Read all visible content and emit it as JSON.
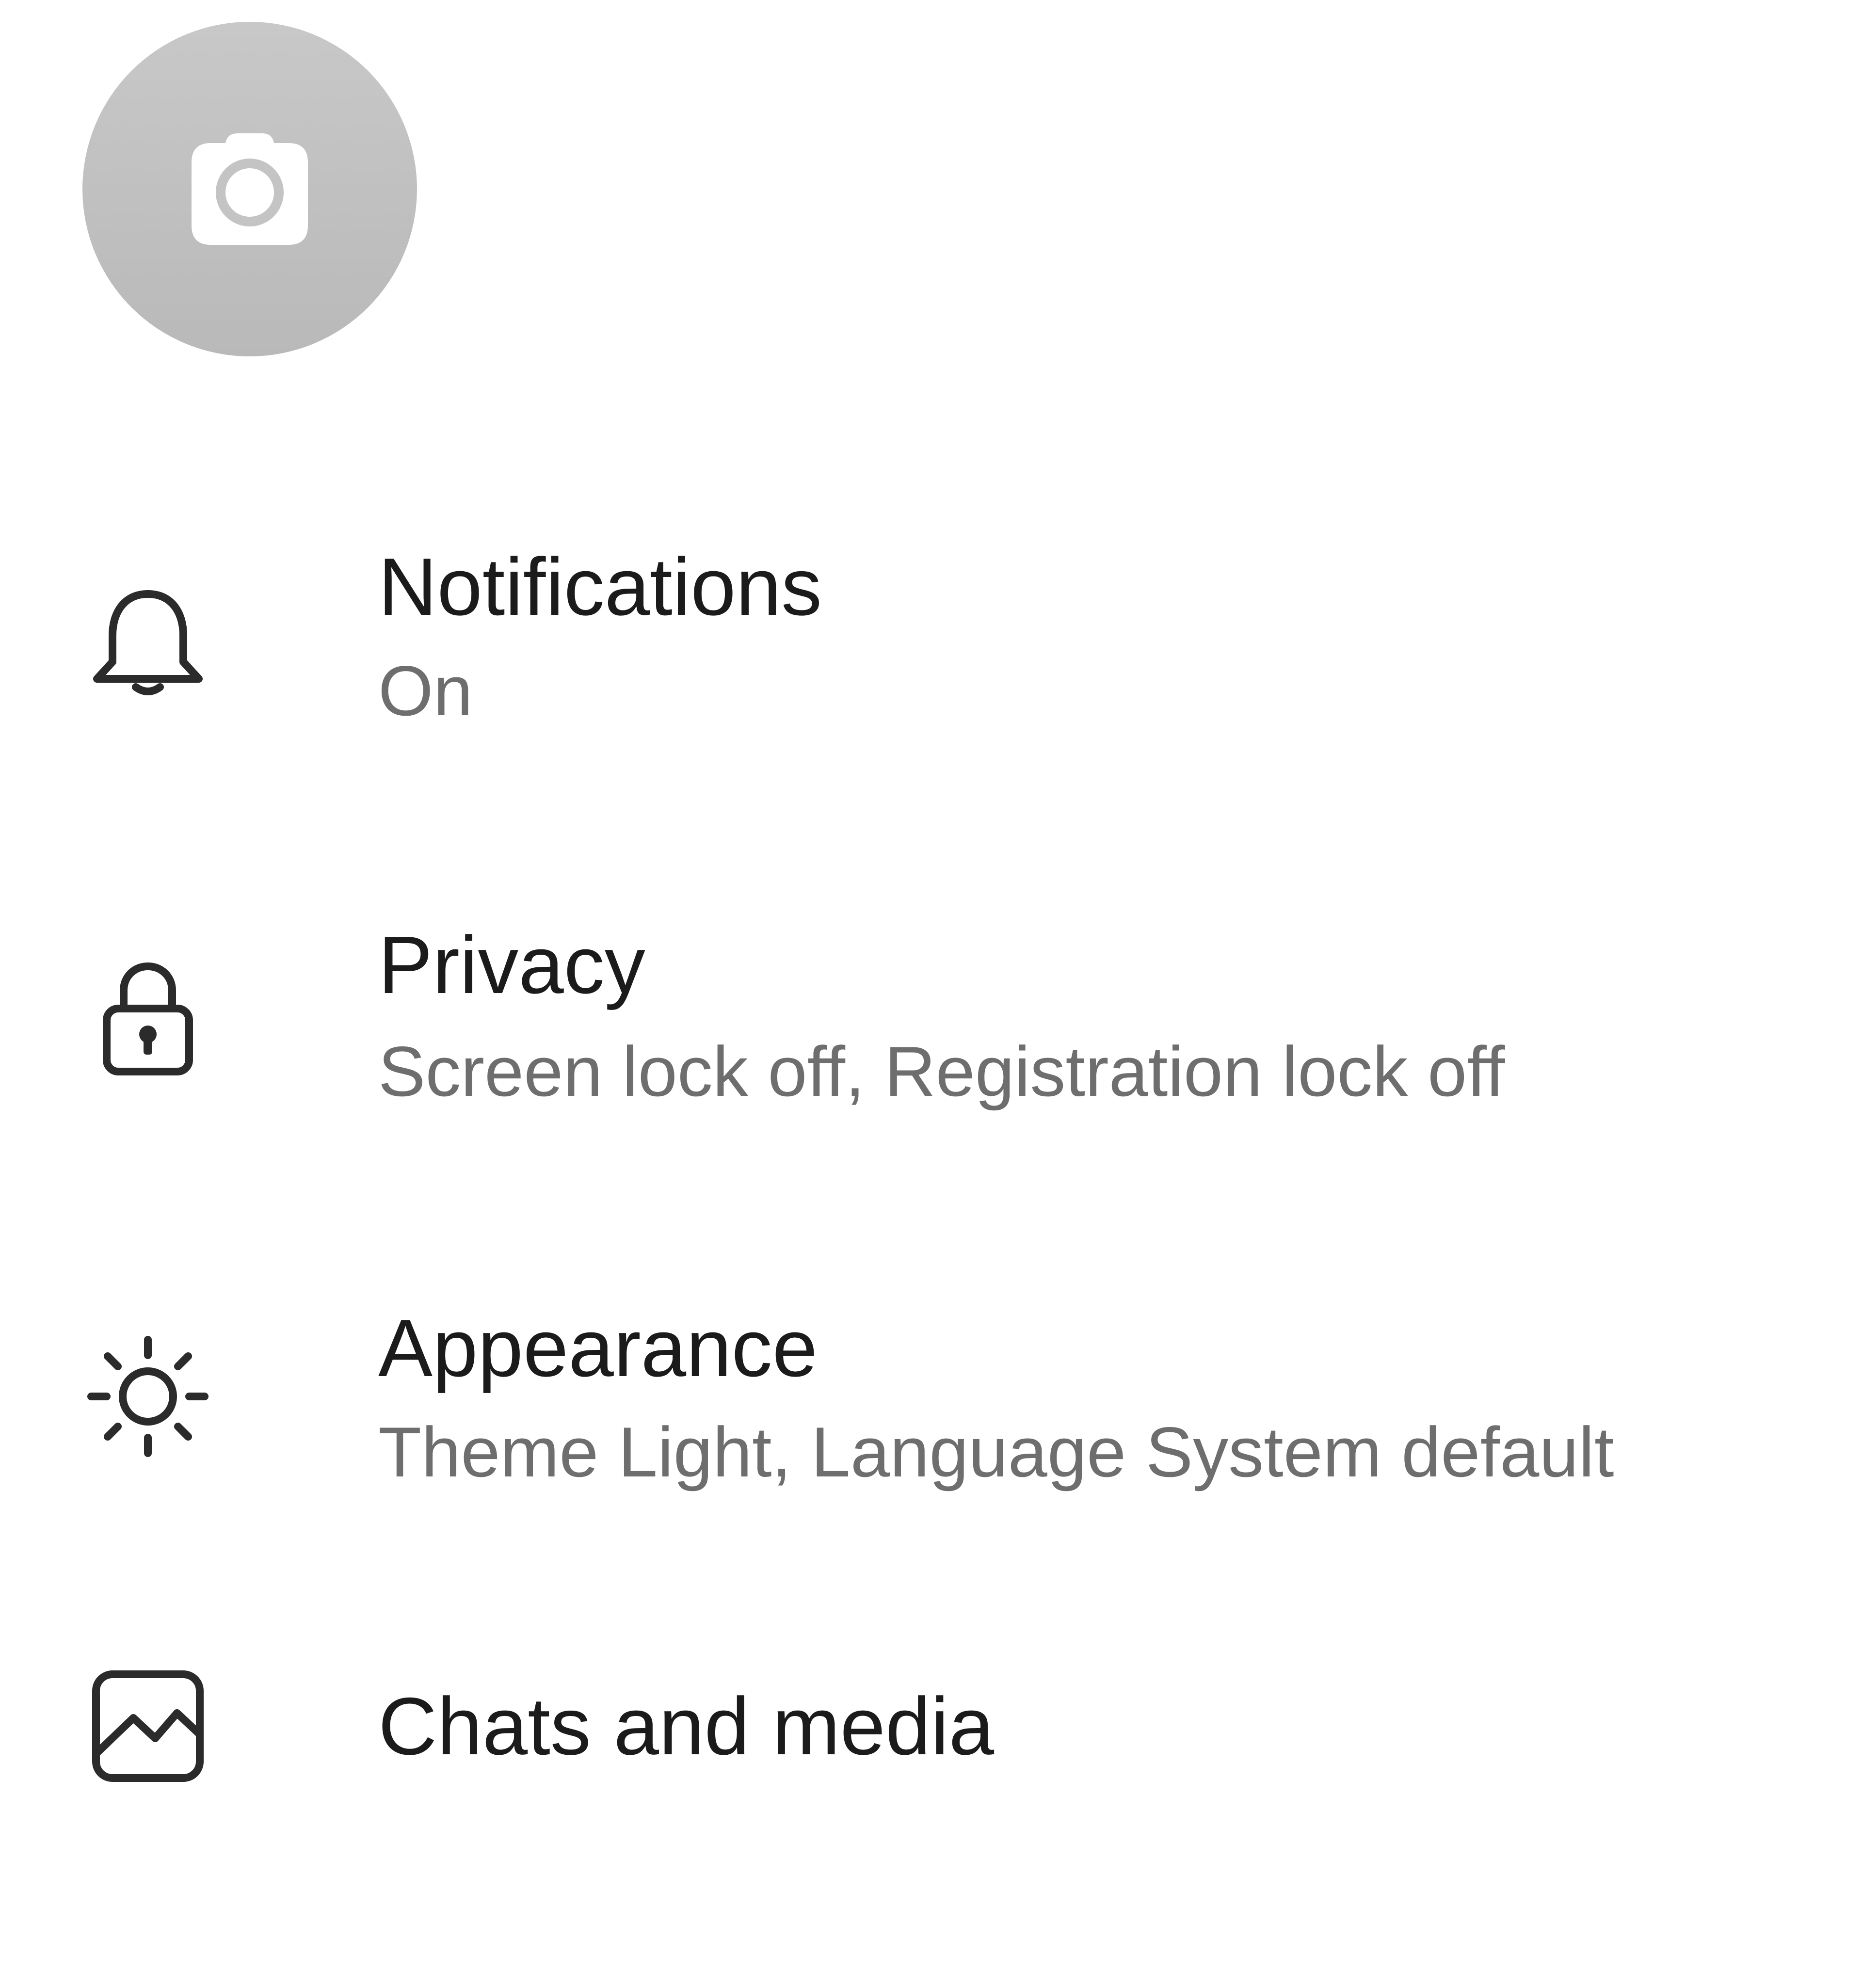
{
  "profile": {
    "avatar_icon": "camera-icon",
    "avatar_color": "#c2c2c2"
  },
  "settings": {
    "items": [
      {
        "icon": "bell-icon",
        "title": "Notifications",
        "summary": "On"
      },
      {
        "icon": "lock-icon",
        "title": "Privacy",
        "summary": "Screen lock off, Registration lock off"
      },
      {
        "icon": "sun-icon",
        "title": "Appearance",
        "summary": "Theme Light, Language System default"
      },
      {
        "icon": "image-icon",
        "title": "Chats and media"
      }
    ]
  },
  "colors": {
    "title_text": "#1b1b1b",
    "summary_text": "#6e6e6e",
    "icon_stroke": "#2b2b2b"
  }
}
